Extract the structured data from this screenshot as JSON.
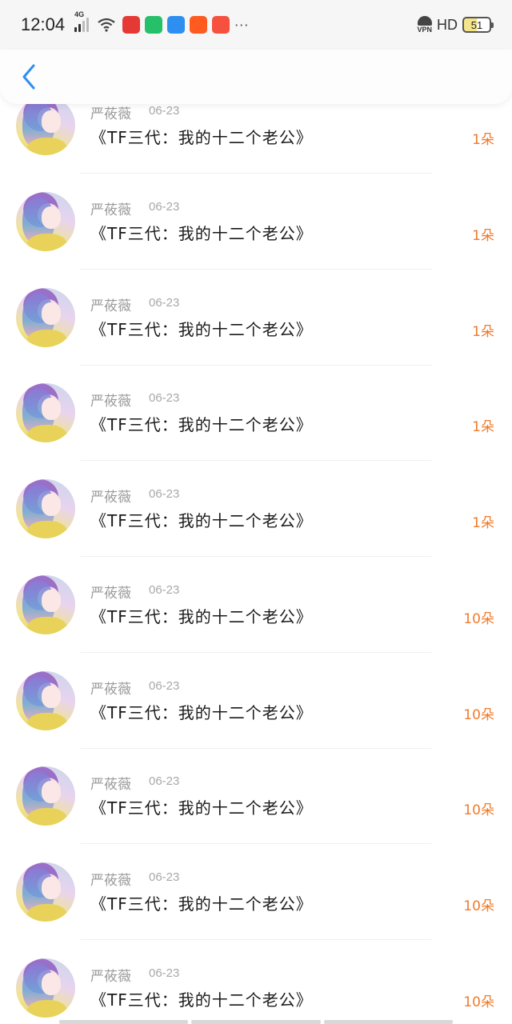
{
  "status_bar": {
    "time": "12:04",
    "network": "4G",
    "vpn_label": "VPN",
    "hd_label": "HD",
    "battery_level": "51",
    "more": "···",
    "app_icons": [
      {
        "name": "baidu-app-icon",
        "color": "#e53935"
      },
      {
        "name": "message-app-icon",
        "color": "#27c06a"
      },
      {
        "name": "browser-app-icon",
        "color": "#2e8ff0"
      },
      {
        "name": "kuaishou-app-icon",
        "color": "#ff5a1f"
      },
      {
        "name": "game-app-icon",
        "color": "#f6503f"
      }
    ]
  },
  "header": {
    "back_icon": "chevron-left-icon",
    "accent": "#2e8ff0"
  },
  "list": {
    "items": [
      {
        "name": "严莜薇",
        "date": "06-23",
        "title": "《TF三代：我的十二个老公》",
        "count": "1朵"
      },
      {
        "name": "严莜薇",
        "date": "06-23",
        "title": "《TF三代：我的十二个老公》",
        "count": "1朵"
      },
      {
        "name": "严莜薇",
        "date": "06-23",
        "title": "《TF三代：我的十二个老公》",
        "count": "1朵"
      },
      {
        "name": "严莜薇",
        "date": "06-23",
        "title": "《TF三代：我的十二个老公》",
        "count": "1朵"
      },
      {
        "name": "严莜薇",
        "date": "06-23",
        "title": "《TF三代：我的十二个老公》",
        "count": "1朵"
      },
      {
        "name": "严莜薇",
        "date": "06-23",
        "title": "《TF三代：我的十二个老公》",
        "count": "10朵"
      },
      {
        "name": "严莜薇",
        "date": "06-23",
        "title": "《TF三代：我的十二个老公》",
        "count": "10朵"
      },
      {
        "name": "严莜薇",
        "date": "06-23",
        "title": "《TF三代：我的十二个老公》",
        "count": "10朵"
      },
      {
        "name": "严莜薇",
        "date": "06-23",
        "title": "《TF三代：我的十二个老公》",
        "count": "10朵"
      },
      {
        "name": "严莜薇",
        "date": "06-23",
        "title": "《TF三代：我的十二个老公》",
        "count": "10朵"
      }
    ],
    "count_color": "#f07a2a"
  }
}
